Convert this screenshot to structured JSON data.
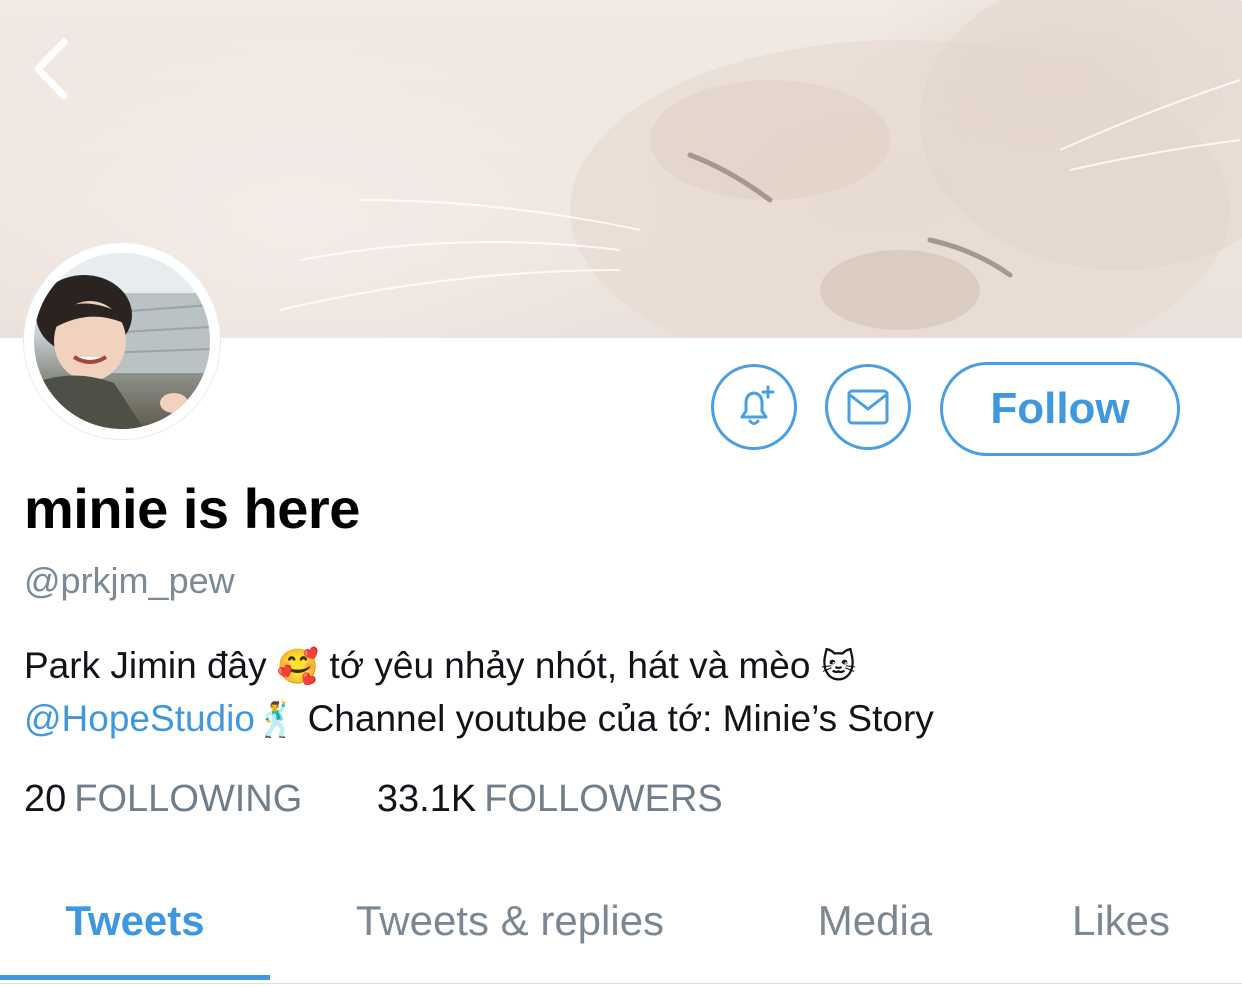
{
  "header": {
    "back_icon": "chevron-left-icon"
  },
  "profile": {
    "display_name": "minie is here",
    "handle": "@prkjm_pew",
    "bio_line1_text": "Park Jimin đây",
    "bio_emoji1": "🥰",
    "bio_line1_text2": "tớ yêu nhảy nhót, hát và mèo",
    "bio_emoji2": "🐱",
    "bio_mention": "@HopeStudio",
    "bio_emoji3": "🕺",
    "bio_line2_text": "Channel youtube của tớ: Minie’s Story"
  },
  "actions": {
    "notify_icon": "bell-plus-icon",
    "message_icon": "envelope-icon",
    "follow_label": "Follow"
  },
  "stats": {
    "following_count": "20",
    "following_label": "FOLLOWING",
    "followers_count": "33.1K",
    "followers_label": "FOLLOWERS"
  },
  "tabs": [
    {
      "label": "Tweets"
    },
    {
      "label": "Tweets & replies"
    },
    {
      "label": "Media"
    },
    {
      "label": "Likes"
    }
  ],
  "colors": {
    "accent": "#3f97de",
    "muted": "#7a8a96",
    "text": "#101418"
  }
}
